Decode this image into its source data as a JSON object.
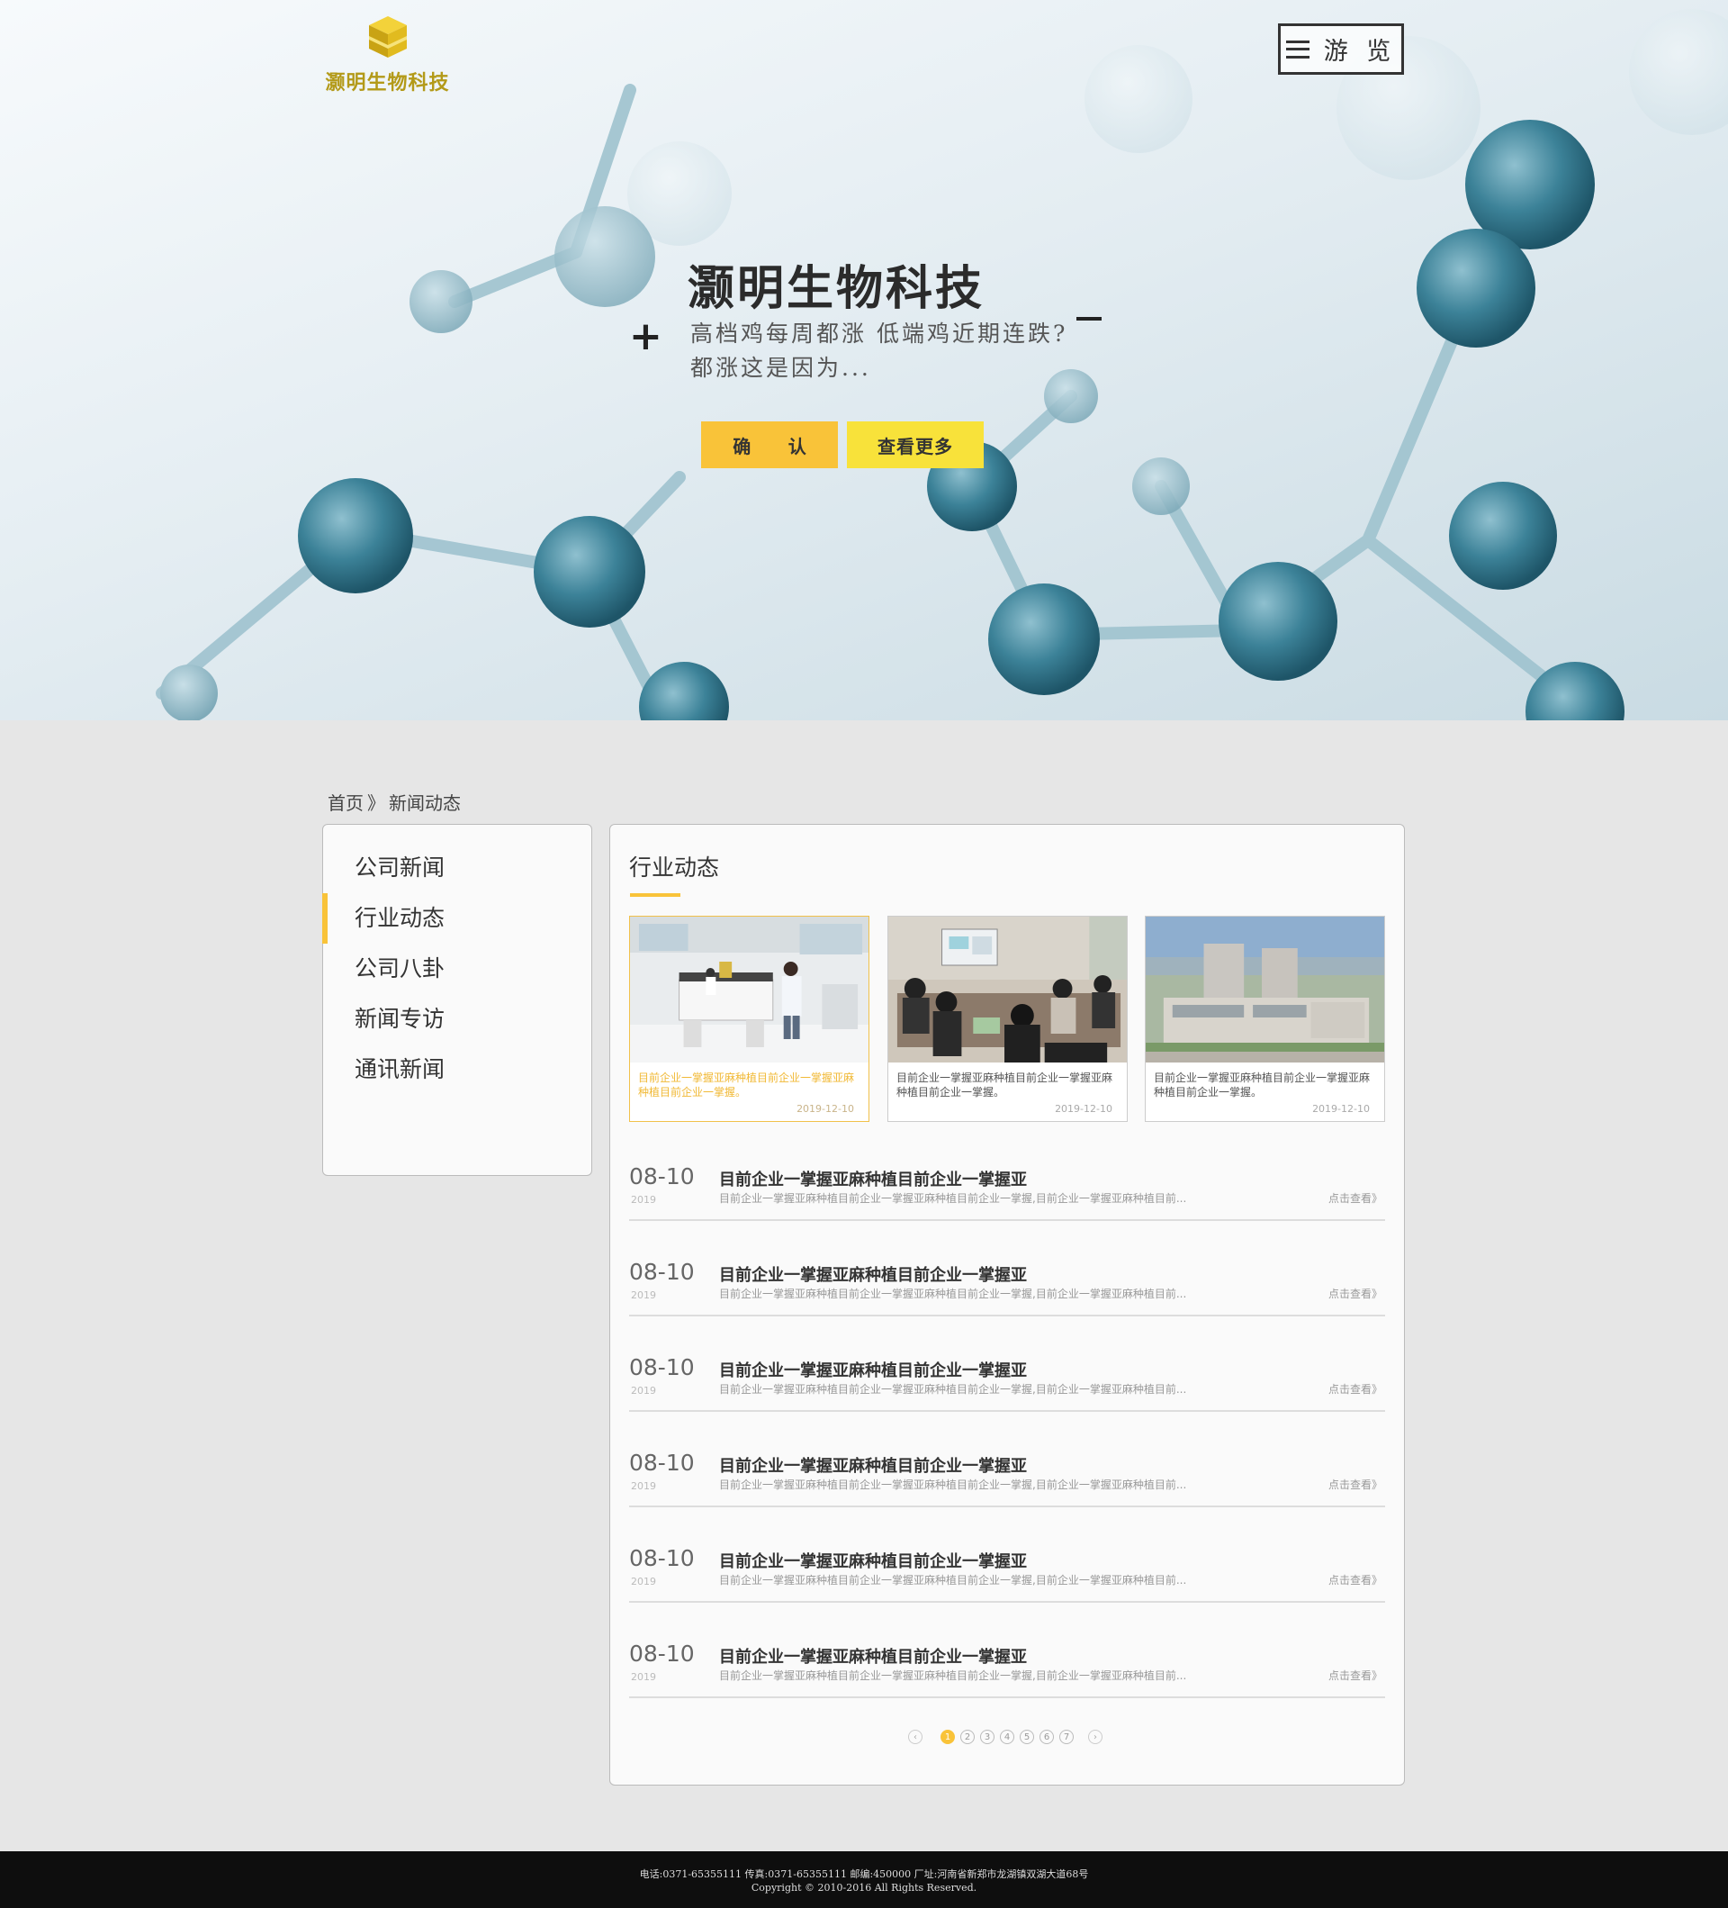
{
  "header": {
    "logo_text": "灏明生物科技",
    "nav_label": "游 览"
  },
  "hero": {
    "title": "灏明生物科技",
    "subtitle_line1": "高档鸡每周都涨 低端鸡近期连跌?",
    "subtitle_line2": "都涨这是因为...",
    "confirm_label": "确 认",
    "more_label": "查看更多"
  },
  "breadcrumb": {
    "home": "首页",
    "separator": "》",
    "current": "新闻动态"
  },
  "sidebar": {
    "items": [
      {
        "label": "公司新闻",
        "active": false
      },
      {
        "label": "行业动态",
        "active": true
      },
      {
        "label": "公司八卦",
        "active": false
      },
      {
        "label": "新闻专访",
        "active": false
      },
      {
        "label": "通讯新闻",
        "active": false
      }
    ]
  },
  "main": {
    "section_title": "行业动态",
    "cards": [
      {
        "text": "目前企业一掌握亚麻种植目前企业一掌握亚麻种植目前企业一掌握。",
        "date": "2019-12-10",
        "image": "laboratory-photo",
        "active": true
      },
      {
        "text": "目前企业一掌握亚麻种植目前企业一掌握亚麻种植目前企业一掌握。",
        "date": "2019-12-10",
        "image": "meeting-photo",
        "active": false
      },
      {
        "text": "目前企业一掌握亚麻种植目前企业一掌握亚麻种植目前企业一掌握。",
        "date": "2019-12-10",
        "image": "factory-photo",
        "active": false
      }
    ],
    "news": [
      {
        "md": "08-10",
        "year": "2019",
        "title": "目前企业一掌握亚麻种植目前企业一掌握亚",
        "desc": "目前企业一掌握亚麻种植目前企业一掌握亚麻种植目前企业一掌握,目前企业一掌握亚麻种植目前...",
        "more": "点击查看》"
      },
      {
        "md": "08-10",
        "year": "2019",
        "title": "目前企业一掌握亚麻种植目前企业一掌握亚",
        "desc": "目前企业一掌握亚麻种植目前企业一掌握亚麻种植目前企业一掌握,目前企业一掌握亚麻种植目前...",
        "more": "点击查看》"
      },
      {
        "md": "08-10",
        "year": "2019",
        "title": "目前企业一掌握亚麻种植目前企业一掌握亚",
        "desc": "目前企业一掌握亚麻种植目前企业一掌握亚麻种植目前企业一掌握,目前企业一掌握亚麻种植目前...",
        "more": "点击查看》"
      },
      {
        "md": "08-10",
        "year": "2019",
        "title": "目前企业一掌握亚麻种植目前企业一掌握亚",
        "desc": "目前企业一掌握亚麻种植目前企业一掌握亚麻种植目前企业一掌握,目前企业一掌握亚麻种植目前...",
        "more": "点击查看》"
      },
      {
        "md": "08-10",
        "year": "2019",
        "title": "目前企业一掌握亚麻种植目前企业一掌握亚",
        "desc": "目前企业一掌握亚麻种植目前企业一掌握亚麻种植目前企业一掌握,目前企业一掌握亚麻种植目前...",
        "more": "点击查看》"
      },
      {
        "md": "08-10",
        "year": "2019",
        "title": "目前企业一掌握亚麻种植目前企业一掌握亚",
        "desc": "目前企业一掌握亚麻种植目前企业一掌握亚麻种植目前企业一掌握,目前企业一掌握亚麻种植目前...",
        "more": "点击查看》"
      }
    ],
    "pagination": {
      "prev": "‹",
      "pages": [
        "1",
        "2",
        "3",
        "4",
        "5",
        "6",
        "7"
      ],
      "current": "1",
      "next": "›"
    }
  },
  "footer": {
    "line1": "电话:0371-65355111 传真:0371-65355111 邮编:450000 厂址:河南省新郑市龙湖镇双湖大道68号",
    "line2": "Copyright © 2010-2016 All Rights Reserved."
  },
  "colors": {
    "accent": "#f9c339",
    "accent_light": "#f8e23a",
    "logo_gold": "#b39a19",
    "footer_bg": "#0e0e0e"
  }
}
